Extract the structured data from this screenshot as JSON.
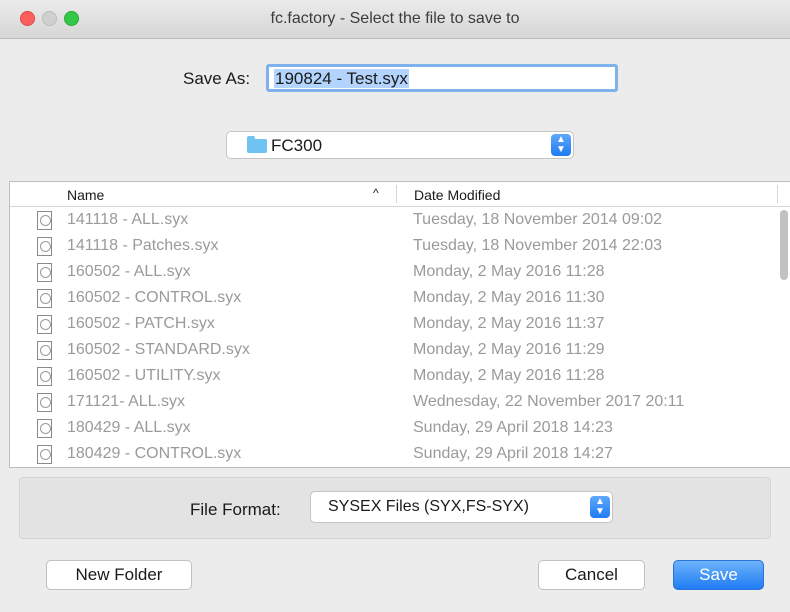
{
  "window": {
    "title": "fc.factory - Select the file to save to"
  },
  "save_as": {
    "label": "Save As:",
    "value": "190824 - Test.syx"
  },
  "location": {
    "folder": "FC300",
    "icon": "folder-icon"
  },
  "columns": {
    "name": "Name",
    "date": "Date Modified"
  },
  "files": [
    {
      "name": "141118 - ALL.syx",
      "date": "Tuesday, 18 November 2014 09:02"
    },
    {
      "name": "141118 - Patches.syx",
      "date": "Tuesday, 18 November 2014 22:03"
    },
    {
      "name": "160502 - ALL.syx",
      "date": "Monday, 2 May 2016 11:28"
    },
    {
      "name": "160502 - CONTROL.syx",
      "date": "Monday, 2 May 2016 11:30"
    },
    {
      "name": "160502 - PATCH.syx",
      "date": "Monday, 2 May 2016 11:37"
    },
    {
      "name": "160502 - STANDARD.syx",
      "date": "Monday, 2 May 2016 11:29"
    },
    {
      "name": "160502 - UTILITY.syx",
      "date": "Monday, 2 May 2016 11:28"
    },
    {
      "name": "171121- ALL.syx",
      "date": "Wednesday, 22 November 2017 20:11"
    },
    {
      "name": "180429 - ALL.syx",
      "date": "Sunday, 29 April 2018 14:23"
    },
    {
      "name": "180429 - CONTROL.syx",
      "date": "Sunday, 29 April 2018 14:27"
    }
  ],
  "file_format": {
    "label": "File Format:",
    "value": "SYSEX Files (SYX,FS-SYX)"
  },
  "buttons": {
    "new_folder": "New Folder",
    "cancel": "Cancel",
    "save": "Save"
  },
  "colors": {
    "accent": "#1f7cf3",
    "selection": "#b3d4fc",
    "disabled_text": "#9a9a9a"
  }
}
